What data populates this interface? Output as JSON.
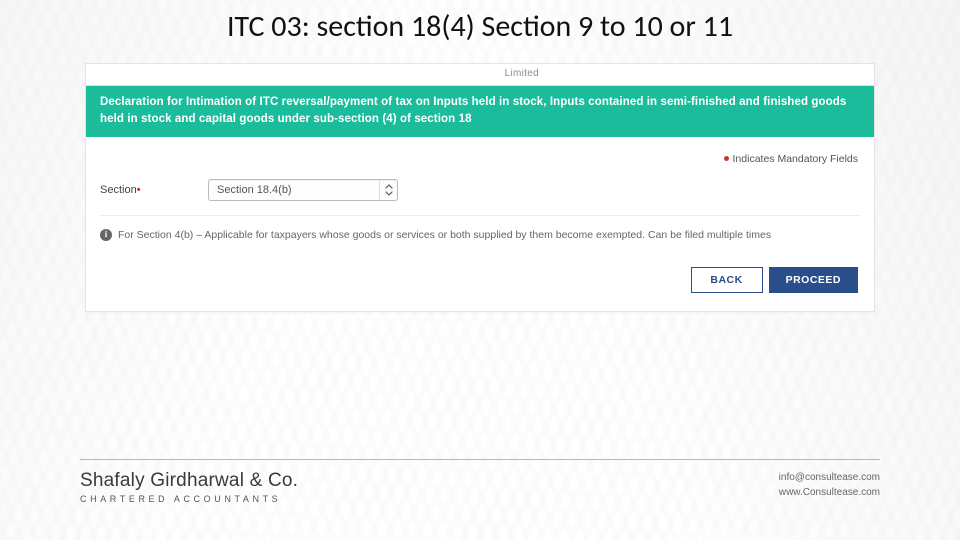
{
  "slide": {
    "title": "ITC 03: section 18(4) Section 9 to 10 or 11"
  },
  "panel": {
    "top_tag": "Limited",
    "banner": "Declaration for Intimation of ITC reversal/payment of tax on Inputs held in stock, Inputs contained in semi-finished and finished goods held in stock and capital goods under sub-section (4) of section 18",
    "mandatory_note": "Indicates Mandatory Fields",
    "section_label": "Section",
    "section_value": "Section 18.4(b)",
    "info_text": "For Section 4(b) – Applicable for taxpayers whose goods or services or both supplied by them become exempted. Can be filed multiple times",
    "back_label": "BACK",
    "proceed_label": "PROCEED"
  },
  "footer": {
    "firm_name": "Shafaly Girdharwal & Co.",
    "firm_sub": "CHARTERED ACCOUNTANTS",
    "email": "info@consultease.com",
    "site": "www.Consultease.com"
  }
}
